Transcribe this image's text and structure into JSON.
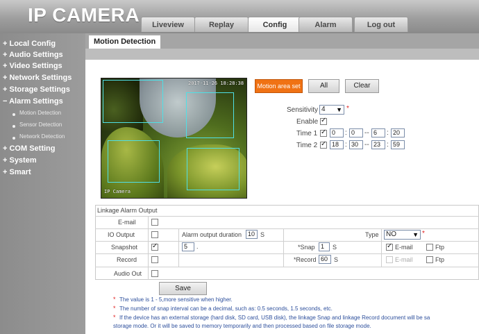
{
  "app": {
    "title": "IP CAMERA"
  },
  "nav_tabs": [
    "Liveview",
    "Replay",
    "Config",
    "Alarm",
    "Log out"
  ],
  "active_tab": "Config",
  "sidebar": {
    "items": [
      {
        "label": "+ Local Config"
      },
      {
        "label": "+ Audio Settings"
      },
      {
        "label": "+ Video Settings"
      },
      {
        "label": "+ Network Settings"
      },
      {
        "label": "+ Storage Settings"
      },
      {
        "label": "− Alarm Settings"
      }
    ],
    "sub_items": [
      "Motion Detection",
      "Sensor Detection",
      "Network Detection"
    ],
    "items_after": [
      {
        "label": "+ COM Setting"
      },
      {
        "label": "+ System"
      },
      {
        "label": "+ Smart"
      }
    ]
  },
  "page": {
    "title": "Motion Detection"
  },
  "camera": {
    "overlay_timestamp": "2017-11-26 18:28:38 SUN",
    "overlay_label": "IP Camera"
  },
  "buttons": {
    "area_set": "Motion area set",
    "all": "All",
    "clear": "Clear",
    "save": "Save"
  },
  "settings": {
    "sensitivity_label": "Sensitivity",
    "sensitivity_value": "4",
    "enable_label": "Enable",
    "enable_checked": true,
    "time1_label": "Time 1",
    "time1_checked": true,
    "time1": [
      "0",
      "0",
      "6",
      "20"
    ],
    "time2_label": "Time 2",
    "time2_checked": true,
    "time2": [
      "18",
      "30",
      "23",
      "59"
    ],
    "sep_colon": ":",
    "sep_range": "--",
    "required_mark": "*"
  },
  "linkage": {
    "title": "Linkage Alarm Output",
    "email_label": "E-mail",
    "io_label": "IO Output",
    "io_duration_label": "Alarm output duration",
    "io_duration_value": "10",
    "io_duration_unit": "S",
    "type_label": "Type",
    "type_value": "NO",
    "snapshot_label": "Snapshot",
    "snapshot_value": "5",
    "snapshot_dot": ".",
    "snap_label": "*Snap",
    "snap_value": "1",
    "snap_unit": "S",
    "record_label": "Record",
    "record_field_label": "*Record",
    "record_value": "60",
    "record_unit": "S",
    "email_opt": "E-mail",
    "ftp_opt": "Ftp",
    "audio_out_label": "Audio Out"
  },
  "notes": [
    "The value is 1 - 5,more sensitive when higher.",
    "The number of snap interval can be a decimal, such as: 0.5 seconds, 1.5 seconds, etc.",
    "If the device has an external storage (hard disk, SD card, USB disk), the linkage Snap and linkage Record document will be sa",
    "storage mode. Or it will be saved to memory temporarily and then processed based on file storage mode."
  ],
  "colors": {
    "accent_orange": "#f07214",
    "note_blue": "#2d4f9c",
    "zone_cyan": "#4fe0e6"
  }
}
